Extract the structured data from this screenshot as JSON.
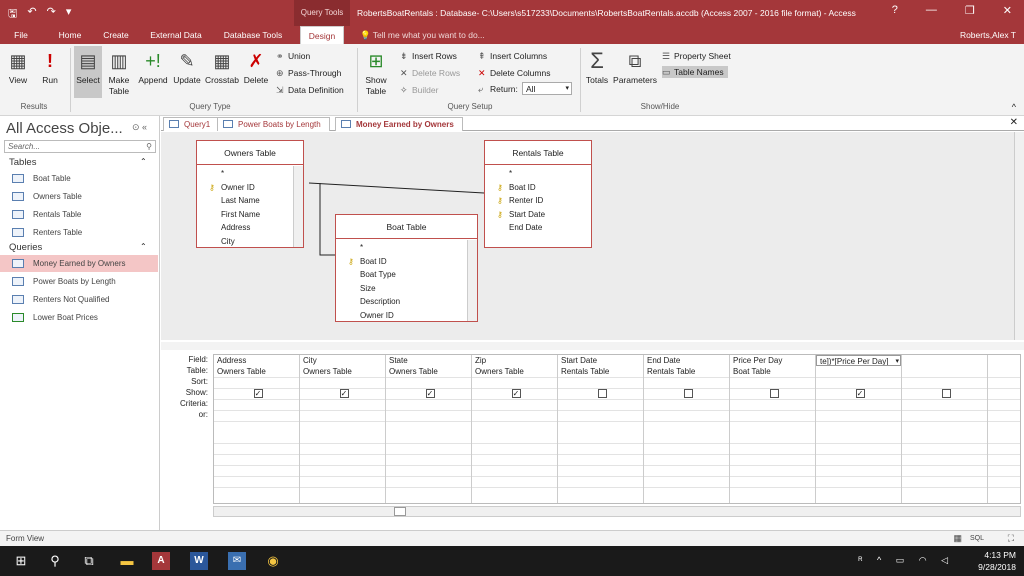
{
  "window": {
    "context_tab": "Query Tools",
    "title": "RobertsBoatRentals : Database- C:\\Users\\s517233\\Documents\\RobertsBoatRentals.accdb (Access 2007 - 2016 file format) - Access",
    "help": "?",
    "minimize": "—",
    "restore": "❐",
    "close": "✕"
  },
  "tabs": [
    {
      "label": "File"
    },
    {
      "label": "Home"
    },
    {
      "label": "Create"
    },
    {
      "label": "External Data"
    },
    {
      "label": "Database Tools"
    },
    {
      "label": "Design"
    }
  ],
  "tell_me": "Tell me what you want to do...",
  "user": "Roberts,Alex T",
  "ribbon": {
    "results": {
      "view": "View",
      "run": "Run",
      "group": "Results"
    },
    "query_type": {
      "select": "Select",
      "make_table": "Make Table",
      "append": "Append",
      "update": "Update",
      "crosstab": "Crosstab",
      "delete": "Delete",
      "union": "Union",
      "pass_through": "Pass-Through",
      "data_definition": "Data Definition",
      "group": "Query Type"
    },
    "query_setup": {
      "show_table": "Show Table",
      "insert_rows": "Insert Rows",
      "delete_rows": "Delete Rows",
      "builder": "Builder",
      "insert_columns": "Insert Columns",
      "delete_columns": "Delete Columns",
      "return_label": "Return:",
      "return_value": "All",
      "group": "Query Setup"
    },
    "show_hide": {
      "totals": "Totals",
      "parameters": "Parameters",
      "property_sheet": "Property Sheet",
      "table_names": "Table Names",
      "group": "Show/Hide"
    }
  },
  "nav": {
    "title": "All Access Obje...",
    "search_placeholder": "Search...",
    "tables_header": "Tables",
    "tables": [
      "Boat Table",
      "Owners Table",
      "Rentals Table",
      "Renters Table"
    ],
    "queries_header": "Queries",
    "queries": [
      "Money Earned by Owners",
      "Power Boats by Length",
      "Renters Not Qualified",
      "Lower Boat Prices"
    ]
  },
  "doc_tabs": [
    "Query1",
    "Power Boats by Length",
    "Money Earned by Owners"
  ],
  "field_lists": {
    "owners": {
      "title": "Owners Table",
      "fields": [
        "*",
        "Owner ID",
        "Last Name",
        "First Name",
        "Address",
        "City"
      ]
    },
    "rentals": {
      "title": "Rentals Table",
      "fields": [
        "*",
        "Boat ID",
        "Renter ID",
        "Start Date",
        "End Date"
      ]
    },
    "boat": {
      "title": "Boat Table",
      "fields": [
        "*",
        "Boat ID",
        "Boat Type",
        "Size",
        "Description",
        "Owner ID"
      ]
    }
  },
  "grid": {
    "row_labels": [
      "Field:",
      "Table:",
      "Sort:",
      "Show:",
      "Criteria:",
      "or:"
    ],
    "columns": [
      {
        "field": "Address",
        "table": "Owners Table",
        "show": "✓"
      },
      {
        "field": "City",
        "table": "Owners Table",
        "show": "✓"
      },
      {
        "field": "State",
        "table": "Owners Table",
        "show": "✓"
      },
      {
        "field": "Zip",
        "table": "Owners Table",
        "show": "✓"
      },
      {
        "field": "Start Date",
        "table": "Rentals Table",
        "show": ""
      },
      {
        "field": "End Date",
        "table": "Rentals Table",
        "show": ""
      },
      {
        "field": "Price Per Day",
        "table": "Boat Table",
        "show": ""
      },
      {
        "field": "te])*[Price Per Day]",
        "table": "",
        "show": "✓"
      },
      {
        "field": "",
        "table": "",
        "show": ""
      }
    ]
  },
  "status": {
    "left": "Form View",
    "sql": "SQL"
  },
  "taskbar": {
    "time": "4:13 PM",
    "date": "9/28/2018"
  }
}
